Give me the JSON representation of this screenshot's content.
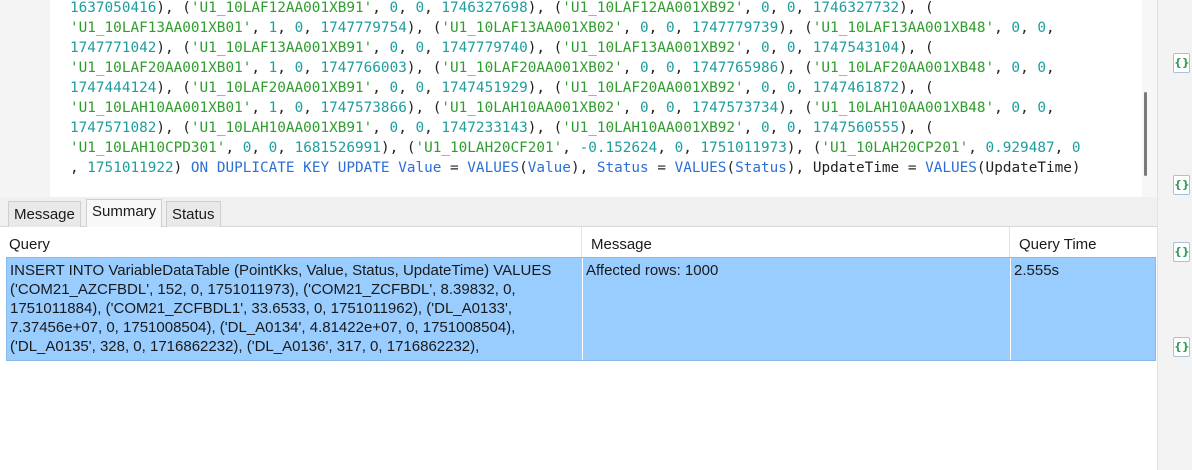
{
  "editor": {
    "lines": [
      [
        [
          "n",
          "1637050416"
        ],
        [
          "p",
          "), ("
        ],
        [
          "s",
          "'U1_10LAF12AA001XB91'"
        ],
        [
          "p",
          ", "
        ],
        [
          "n",
          "0"
        ],
        [
          "p",
          ", "
        ],
        [
          "n",
          "0"
        ],
        [
          "p",
          ", "
        ],
        [
          "n",
          "1746327698"
        ],
        [
          "p",
          "), ("
        ],
        [
          "s",
          "'U1_10LAF12AA001XB92'"
        ],
        [
          "p",
          ", "
        ],
        [
          "n",
          "0"
        ],
        [
          "p",
          ", "
        ],
        [
          "n",
          "0"
        ],
        [
          "p",
          ", "
        ],
        [
          "n",
          "1746327732"
        ],
        [
          "p",
          "), ("
        ]
      ],
      [
        [
          "s",
          "'U1_10LAF13AA001XB01'"
        ],
        [
          "p",
          ", "
        ],
        [
          "n",
          "1"
        ],
        [
          "p",
          ", "
        ],
        [
          "n",
          "0"
        ],
        [
          "p",
          ", "
        ],
        [
          "n",
          "1747779754"
        ],
        [
          "p",
          "), ("
        ],
        [
          "s",
          "'U1_10LAF13AA001XB02'"
        ],
        [
          "p",
          ", "
        ],
        [
          "n",
          "0"
        ],
        [
          "p",
          ", "
        ],
        [
          "n",
          "0"
        ],
        [
          "p",
          ", "
        ],
        [
          "n",
          "1747779739"
        ],
        [
          "p",
          "), ("
        ],
        [
          "s",
          "'U1_10LAF13AA001XB48'"
        ],
        [
          "p",
          ", "
        ],
        [
          "n",
          "0"
        ],
        [
          "p",
          ", "
        ],
        [
          "n",
          "0"
        ],
        [
          "p",
          ","
        ]
      ],
      [
        [
          "n",
          "1747771042"
        ],
        [
          "p",
          "), ("
        ],
        [
          "s",
          "'U1_10LAF13AA001XB91'"
        ],
        [
          "p",
          ", "
        ],
        [
          "n",
          "0"
        ],
        [
          "p",
          ", "
        ],
        [
          "n",
          "0"
        ],
        [
          "p",
          ", "
        ],
        [
          "n",
          "1747779740"
        ],
        [
          "p",
          "), ("
        ],
        [
          "s",
          "'U1_10LAF13AA001XB92'"
        ],
        [
          "p",
          ", "
        ],
        [
          "n",
          "0"
        ],
        [
          "p",
          ", "
        ],
        [
          "n",
          "0"
        ],
        [
          "p",
          ", "
        ],
        [
          "n",
          "1747543104"
        ],
        [
          "p",
          "), ("
        ]
      ],
      [
        [
          "s",
          "'U1_10LAF20AA001XB01'"
        ],
        [
          "p",
          ", "
        ],
        [
          "n",
          "1"
        ],
        [
          "p",
          ", "
        ],
        [
          "n",
          "0"
        ],
        [
          "p",
          ", "
        ],
        [
          "n",
          "1747766003"
        ],
        [
          "p",
          "), ("
        ],
        [
          "s",
          "'U1_10LAF20AA001XB02'"
        ],
        [
          "p",
          ", "
        ],
        [
          "n",
          "0"
        ],
        [
          "p",
          ", "
        ],
        [
          "n",
          "0"
        ],
        [
          "p",
          ", "
        ],
        [
          "n",
          "1747765986"
        ],
        [
          "p",
          "), ("
        ],
        [
          "s",
          "'U1_10LAF20AA001XB48'"
        ],
        [
          "p",
          ", "
        ],
        [
          "n",
          "0"
        ],
        [
          "p",
          ", "
        ],
        [
          "n",
          "0"
        ],
        [
          "p",
          ","
        ]
      ],
      [
        [
          "n",
          "1747444124"
        ],
        [
          "p",
          "), ("
        ],
        [
          "s",
          "'U1_10LAF20AA001XB91'"
        ],
        [
          "p",
          ", "
        ],
        [
          "n",
          "0"
        ],
        [
          "p",
          ", "
        ],
        [
          "n",
          "0"
        ],
        [
          "p",
          ", "
        ],
        [
          "n",
          "1747451929"
        ],
        [
          "p",
          "), ("
        ],
        [
          "s",
          "'U1_10LAF20AA001XB92'"
        ],
        [
          "p",
          ", "
        ],
        [
          "n",
          "0"
        ],
        [
          "p",
          ", "
        ],
        [
          "n",
          "0"
        ],
        [
          "p",
          ", "
        ],
        [
          "n",
          "1747461872"
        ],
        [
          "p",
          "), ("
        ]
      ],
      [
        [
          "s",
          "'U1_10LAH10AA001XB01'"
        ],
        [
          "p",
          ", "
        ],
        [
          "n",
          "1"
        ],
        [
          "p",
          ", "
        ],
        [
          "n",
          "0"
        ],
        [
          "p",
          ", "
        ],
        [
          "n",
          "1747573866"
        ],
        [
          "p",
          "), ("
        ],
        [
          "s",
          "'U1_10LAH10AA001XB02'"
        ],
        [
          "p",
          ", "
        ],
        [
          "n",
          "0"
        ],
        [
          "p",
          ", "
        ],
        [
          "n",
          "0"
        ],
        [
          "p",
          ", "
        ],
        [
          "n",
          "1747573734"
        ],
        [
          "p",
          "), ("
        ],
        [
          "s",
          "'U1_10LAH10AA001XB48'"
        ],
        [
          "p",
          ", "
        ],
        [
          "n",
          "0"
        ],
        [
          "p",
          ", "
        ],
        [
          "n",
          "0"
        ],
        [
          "p",
          ","
        ]
      ],
      [
        [
          "n",
          "1747571082"
        ],
        [
          "p",
          "), ("
        ],
        [
          "s",
          "'U1_10LAH10AA001XB91'"
        ],
        [
          "p",
          ", "
        ],
        [
          "n",
          "0"
        ],
        [
          "p",
          ", "
        ],
        [
          "n",
          "0"
        ],
        [
          "p",
          ", "
        ],
        [
          "n",
          "1747233143"
        ],
        [
          "p",
          "), ("
        ],
        [
          "s",
          "'U1_10LAH10AA001XB92'"
        ],
        [
          "p",
          ", "
        ],
        [
          "n",
          "0"
        ],
        [
          "p",
          ", "
        ],
        [
          "n",
          "0"
        ],
        [
          "p",
          ", "
        ],
        [
          "n",
          "1747560555"
        ],
        [
          "p",
          "), ("
        ]
      ],
      [
        [
          "s",
          "'U1_10LAH10CPD301'"
        ],
        [
          "p",
          ", "
        ],
        [
          "n",
          "0"
        ],
        [
          "p",
          ", "
        ],
        [
          "n",
          "0"
        ],
        [
          "p",
          ", "
        ],
        [
          "n",
          "1681526991"
        ],
        [
          "p",
          "), ("
        ],
        [
          "s",
          "'U1_10LAH20CF201'"
        ],
        [
          "p",
          ", "
        ],
        [
          "n",
          "-0.152624"
        ],
        [
          "p",
          ", "
        ],
        [
          "n",
          "0"
        ],
        [
          "p",
          ", "
        ],
        [
          "n",
          "1751011973"
        ],
        [
          "p",
          "), ("
        ],
        [
          "s",
          "'U1_10LAH20CP201'"
        ],
        [
          "p",
          ", "
        ],
        [
          "n",
          "0.929487"
        ],
        [
          "p",
          ", "
        ],
        [
          "n",
          "0"
        ]
      ],
      [
        [
          "p",
          ", "
        ],
        [
          "n",
          "1751011922"
        ],
        [
          "p",
          ") "
        ],
        [
          "k",
          "ON DUPLICATE KEY UPDATE"
        ],
        [
          "p",
          " "
        ],
        [
          "k",
          "Value"
        ],
        [
          "p",
          " = "
        ],
        [
          "k",
          "VALUES"
        ],
        [
          "p",
          "("
        ],
        [
          "k",
          "Value"
        ],
        [
          "p",
          "), "
        ],
        [
          "k",
          "Status"
        ],
        [
          "p",
          " = "
        ],
        [
          "k",
          "VALUES"
        ],
        [
          "p",
          "("
        ],
        [
          "k",
          "Status"
        ],
        [
          "p",
          "), UpdateTime = "
        ],
        [
          "k",
          "VALUES"
        ],
        [
          "p",
          "(UpdateTime)"
        ]
      ]
    ]
  },
  "tabs": [
    {
      "label": "Message",
      "active": false
    },
    {
      "label": "Summary",
      "active": true
    },
    {
      "label": "Status",
      "active": false
    }
  ],
  "results": {
    "columns": [
      "Query",
      "Message",
      "Query Time"
    ],
    "rows": [
      {
        "query_lines": [
          "INSERT INTO VariableDataTable (PointKks, Value, Status, UpdateTime) VALUES",
          "('COM21_AZCFBDL', 152, 0, 1751011973), ('COM21_ZCFBDL', 8.39832, 0,",
          "1751011884), ('COM21_ZCFBDL1', 33.6533, 0, 1751011962), ('DL_A0133',",
          "7.37456e+07, 0, 1751008504), ('DL_A0134', 4.81422e+07, 0, 1751008504),",
          "('DL_A0135', 328, 0, 1716862232), ('DL_A0136', 317, 0, 1716862232),"
        ],
        "message": "Affected rows: 1000",
        "query_time": "2.555s"
      }
    ]
  },
  "side_icons": [
    {
      "name": "code-file-icon",
      "glyph": "{}"
    },
    {
      "name": "code-file-icon",
      "glyph": "{}"
    },
    {
      "name": "code-file-icon",
      "glyph": "{}"
    },
    {
      "name": "code-file-icon",
      "glyph": "{}"
    }
  ],
  "colors": {
    "string": "#2e9d2e",
    "number": "#1d9d9d",
    "keyword": "#2b6fd6",
    "selected_row": "#99ccff"
  }
}
